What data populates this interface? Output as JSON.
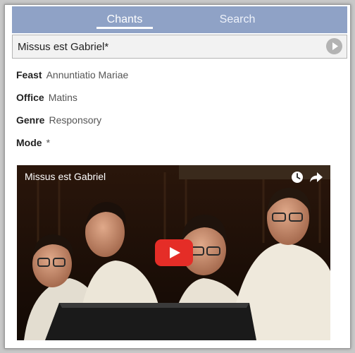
{
  "tabs": {
    "chants_label": "Chants",
    "search_label": "Search"
  },
  "chant": {
    "title": "Missus est Gabriel*"
  },
  "details": {
    "feast_label": "Feast",
    "feast_value": "Annuntiatio Mariae",
    "office_label": "Office",
    "office_value": "Matins",
    "genre_label": "Genre",
    "genre_value": "Responsory",
    "mode_label": "Mode",
    "mode_value": "*"
  },
  "video": {
    "title": "Missus est Gabriel",
    "icons": [
      "clock-icon",
      "share-icon",
      "youtube-play-icon"
    ]
  },
  "colors": {
    "tabbar": "#8fa2c6",
    "youtube_red": "#e52d27",
    "play_circle": "#b3b3b3"
  }
}
